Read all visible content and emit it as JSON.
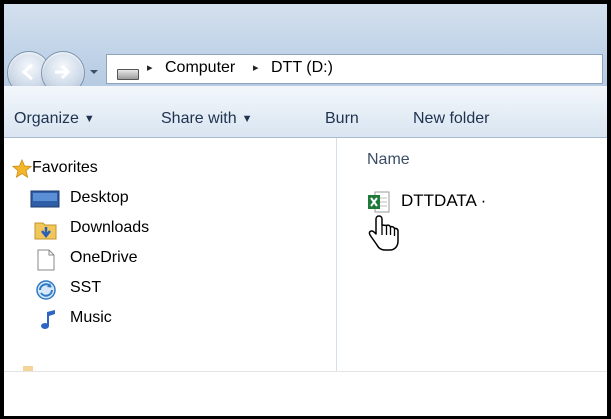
{
  "address_bar": {
    "breadcrumbs": [
      "Computer",
      "DTT (D:)"
    ],
    "separator": "▸"
  },
  "toolbar": {
    "organize_label": "Organize",
    "share_label": "Share with",
    "burn_label": "Burn",
    "new_folder_label": "New folder",
    "caret": "▼"
  },
  "nav_pane": {
    "items": [
      {
        "label": "Favorites",
        "icon": "star-icon"
      },
      {
        "label": "Desktop",
        "icon": "desktop-icon"
      },
      {
        "label": "Downloads",
        "icon": "downloads-folder-icon"
      },
      {
        "label": "OneDrive",
        "icon": "document-icon"
      },
      {
        "label": "SST",
        "icon": "refresh-icon"
      },
      {
        "label": "Music",
        "icon": "music-note-icon"
      }
    ]
  },
  "content": {
    "column_header": "Name",
    "files": [
      {
        "name": "DTTDATA ·",
        "icon": "excel-file-icon"
      }
    ]
  },
  "colors": {
    "excel_green": "#1f7a3a",
    "toolbar_text": "#1e3350",
    "address_bar_bg": "#c2d4e8"
  }
}
